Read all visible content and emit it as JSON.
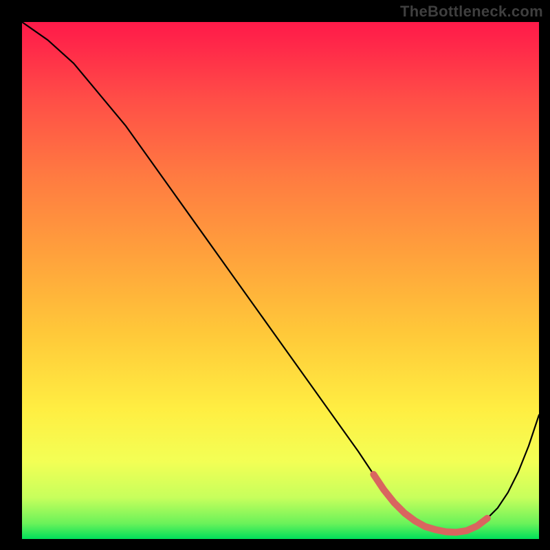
{
  "branding": {
    "watermark": "TheBottleneck.com"
  },
  "colors": {
    "page_bg": "#000000",
    "gradient_top": "#ff1a49",
    "gradient_mid": "#ffae3d",
    "gradient_lower": "#ffff66",
    "gradient_bottom": "#00e05a",
    "curve": "#000000",
    "marker": "#d9655f"
  },
  "chart_data": {
    "type": "line",
    "title": "",
    "xlabel": "",
    "ylabel": "",
    "xlim": [
      0,
      100
    ],
    "ylim": [
      0,
      100
    ],
    "x": [
      0,
      5,
      10,
      15,
      20,
      25,
      30,
      35,
      40,
      45,
      50,
      55,
      60,
      65,
      68,
      70,
      72,
      74,
      76,
      78,
      80,
      82,
      84,
      86,
      88,
      90,
      92,
      94,
      96,
      98,
      100
    ],
    "values": [
      100,
      96.5,
      92,
      86,
      80,
      73,
      66,
      59,
      52,
      45,
      38,
      31,
      24,
      17,
      12.5,
      9.5,
      7,
      5,
      3.5,
      2.4,
      1.8,
      1.4,
      1.3,
      1.6,
      2.5,
      4,
      6,
      9,
      13,
      18,
      24
    ],
    "marked_region": {
      "x": [
        68,
        70,
        72,
        74,
        76,
        78,
        80,
        82,
        84,
        86,
        88,
        90
      ],
      "values": [
        12.5,
        9.5,
        7,
        5,
        3.5,
        2.4,
        1.8,
        1.4,
        1.3,
        1.6,
        2.5,
        4
      ]
    },
    "gradient_stops": [
      {
        "offset": 0.0,
        "color": "#ff1a49"
      },
      {
        "offset": 0.05,
        "color": "#ff2a49"
      },
      {
        "offset": 0.15,
        "color": "#ff4e47"
      },
      {
        "offset": 0.3,
        "color": "#ff7b41"
      },
      {
        "offset": 0.45,
        "color": "#ffa13c"
      },
      {
        "offset": 0.6,
        "color": "#ffc839"
      },
      {
        "offset": 0.75,
        "color": "#ffee42"
      },
      {
        "offset": 0.85,
        "color": "#f3ff55"
      },
      {
        "offset": 0.92,
        "color": "#c7ff5c"
      },
      {
        "offset": 0.97,
        "color": "#6af25a"
      },
      {
        "offset": 1.0,
        "color": "#00e05a"
      }
    ]
  }
}
